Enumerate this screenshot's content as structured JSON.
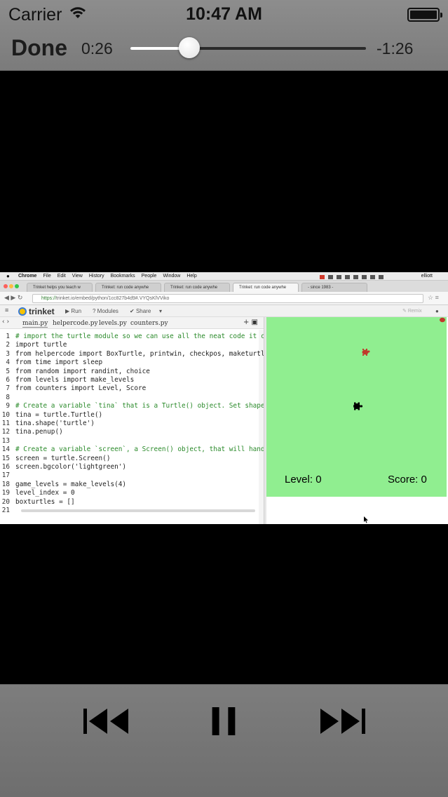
{
  "status": {
    "carrier": "Carrier",
    "time": "10:47 AM"
  },
  "player": {
    "done_label": "Done",
    "elapsed": "0:26",
    "remaining": "-1:26",
    "progress_fraction": 0.25
  },
  "video": {
    "mac_menu": {
      "items": [
        "Chrome",
        "File",
        "Edit",
        "View",
        "History",
        "Bookmarks",
        "People",
        "Window",
        "Help"
      ],
      "user": "elliott"
    },
    "browser_tabs": [
      {
        "label": "Trinket helps you teach w"
      },
      {
        "label": "Trinket: run code anywhe"
      },
      {
        "label": "Trinket: run code anywhe"
      },
      {
        "label": "Trinket: run code anywhe"
      },
      {
        "label": "- since 1983 -"
      }
    ],
    "url": {
      "scheme": "https://",
      "rest": "trinket.io/embed/python/1cc827b4d9#.VYQsKlVViko"
    },
    "trinket": {
      "logo": "trinket",
      "run": "Run",
      "modules": "Modules",
      "share": "Share",
      "remix": "Remix"
    },
    "files": [
      "main.py",
      "helpercode.py",
      "levels.py",
      "counters.py"
    ],
    "code": [
      {
        "n": "1",
        "t": "# import the turtle module so we can use all the neat code it c",
        "comment": true
      },
      {
        "n": "2",
        "t": "import turtle"
      },
      {
        "n": "3",
        "t": "from helpercode import BoxTurtle, printwin, checkpos, maketurtl"
      },
      {
        "n": "4",
        "t": "from time import sleep"
      },
      {
        "n": "5",
        "t": "from random import randint, choice"
      },
      {
        "n": "6",
        "t": "from levels import make_levels"
      },
      {
        "n": "7",
        "t": "from counters import Level, Score"
      },
      {
        "n": "8",
        "t": ""
      },
      {
        "n": "9",
        "t": "# Create a variable `tina` that is a Turtle() object. Set shape",
        "comment": true
      },
      {
        "n": "10",
        "t": "tina = turtle.Turtle()"
      },
      {
        "n": "11",
        "t": "tina.shape('turtle')"
      },
      {
        "n": "12",
        "t": "tina.penup()"
      },
      {
        "n": "13",
        "t": ""
      },
      {
        "n": "14",
        "t": "# Create a variable `screen`, a Screen() object, that will hand",
        "comment": true
      },
      {
        "n": "15",
        "t": "screen = turtle.Screen()"
      },
      {
        "n": "16",
        "t": "screen.bgcolor('lightgreen')"
      },
      {
        "n": "17",
        "t": ""
      },
      {
        "n": "18",
        "t": "game_levels = make_levels(4)"
      },
      {
        "n": "19",
        "t": "level_index = 0"
      },
      {
        "n": "20",
        "t": "boxturtles = []"
      },
      {
        "n": "21",
        "t": ""
      }
    ],
    "canvas": {
      "background": "#90ee90",
      "level_text": "Level: 0",
      "score_text": "Score: 0"
    }
  },
  "controls": {
    "previous": "previous-track-icon",
    "pause": "pause-icon",
    "next": "next-track-icon"
  }
}
